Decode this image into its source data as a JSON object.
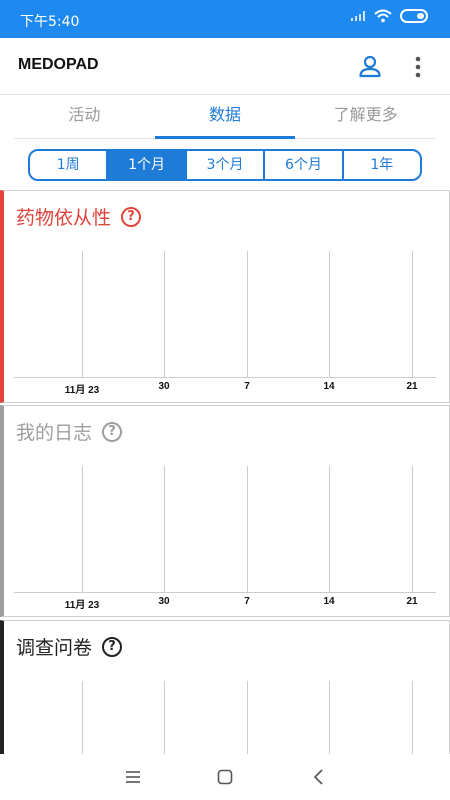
{
  "status_bar": {
    "time": "下午5:40",
    "icons": [
      "signal-icon",
      "wifi-icon",
      "battery-icon"
    ]
  },
  "app_bar": {
    "title": "MEDOPAD",
    "icons": [
      "profile-icon",
      "more-vert-icon"
    ]
  },
  "tabs": [
    {
      "label": "活动",
      "active": false
    },
    {
      "label": "数据",
      "active": true
    },
    {
      "label": "了解更多",
      "active": false
    }
  ],
  "ranges": [
    {
      "label": "1周",
      "active": false
    },
    {
      "label": "1个月",
      "active": true
    },
    {
      "label": "3个月",
      "active": false
    },
    {
      "label": "6个月",
      "active": false
    },
    {
      "label": "1年",
      "active": false
    }
  ],
  "cards": [
    {
      "title": "药物依从性",
      "help": "?",
      "color": "#e0443c",
      "x_ticks": [
        "11月 23",
        "30",
        "7",
        "14",
        "21"
      ]
    },
    {
      "title": "我的日志",
      "help": "?",
      "color": "#9e9e9e",
      "x_ticks": [
        "11月 23",
        "30",
        "7",
        "14",
        "21"
      ]
    },
    {
      "title": "调查问卷",
      "help": "?",
      "color": "#222222",
      "x_ticks": []
    }
  ],
  "colors": {
    "primary": "#1e7bd8",
    "status_bar": "#1e8af0"
  },
  "nav_bar": {
    "icons": [
      "menu-icon",
      "home-square-icon",
      "back-icon"
    ]
  }
}
